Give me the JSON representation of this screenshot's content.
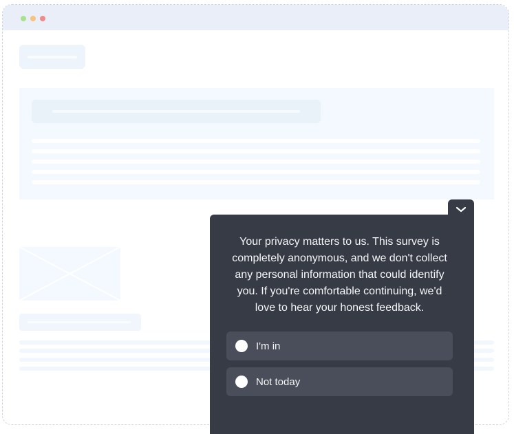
{
  "window": {
    "controls": [
      "minimize-dot",
      "maximize-dot",
      "close-dot"
    ]
  },
  "survey": {
    "collapse_icon": "chevron-down-icon",
    "message": "Your privacy matters to us. This survey is completely anonymous, and we don't collect any personal information that could identify you. If you're comfortable continuing, we'd love to hear your honest feedback.",
    "options": [
      {
        "label": "I'm in"
      },
      {
        "label": "Not today"
      }
    ]
  },
  "colors": {
    "survey_bg": "#373b46",
    "option_bg": "#4a4e5a",
    "titlebar_bg": "#e9eef8",
    "placeholder_bg": "#f3f9fe"
  }
}
